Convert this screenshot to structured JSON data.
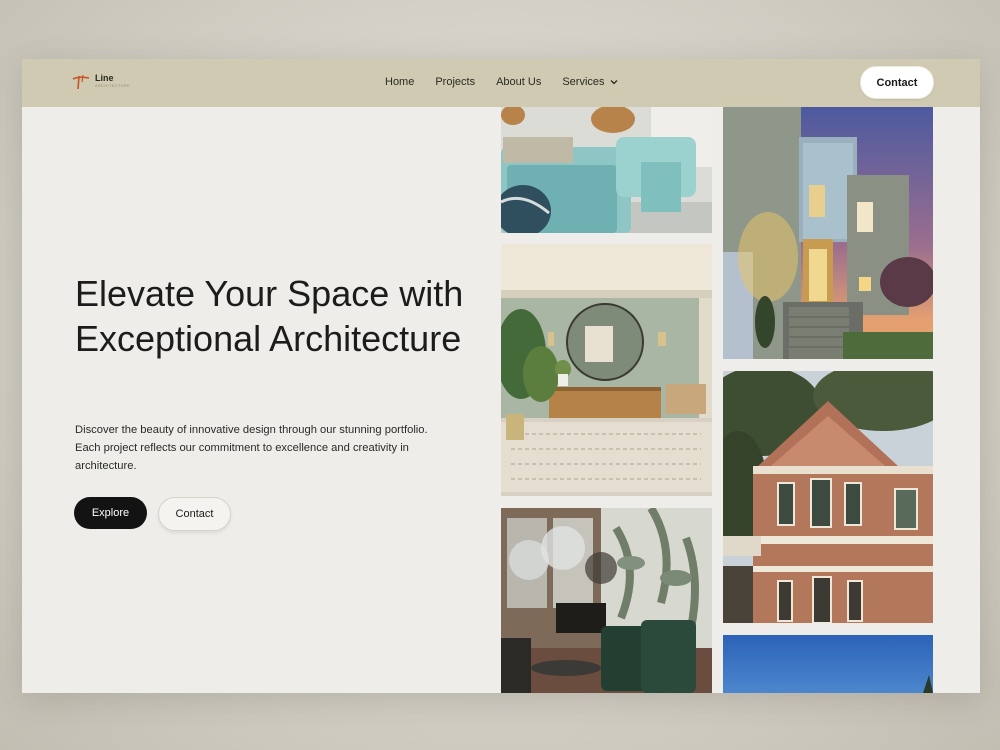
{
  "brand": {
    "name": "Line",
    "tagline": "ARCHITECTURE"
  },
  "nav": {
    "items": [
      {
        "label": "Home"
      },
      {
        "label": "Projects"
      },
      {
        "label": "About Us"
      },
      {
        "label": "Services"
      }
    ],
    "contact_label": "Contact"
  },
  "hero": {
    "title": "Elevate Your Space with Exceptional Architecture",
    "description": "Discover the beauty of innovative design through our stunning portfolio. Each project reflects our commitment to excellence and creativity in architecture.",
    "explore_label": "Explore",
    "contact_label": "Contact"
  },
  "gallery": [
    {
      "name": "teal-living-room-photo"
    },
    {
      "name": "sage-interior-photo"
    },
    {
      "name": "botanical-dining-photo"
    },
    {
      "name": "modern-house-dusk-photo"
    },
    {
      "name": "victorian-house-photo"
    },
    {
      "name": "blue-sky-photo"
    }
  ],
  "colors": {
    "nav_bg": "#cfcab1",
    "page_bg": "#eeede9",
    "accent": "#c4562a",
    "button_dark": "#131313"
  }
}
